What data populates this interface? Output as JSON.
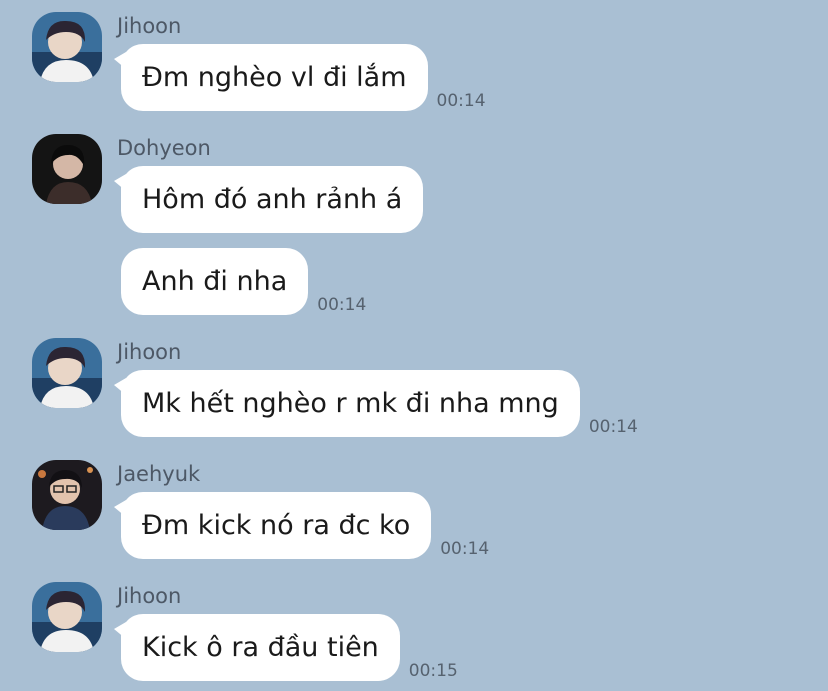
{
  "messages": [
    {
      "sender": "Jihoon",
      "text": "Đm nghèo vl đi lắm",
      "time": "00:14",
      "avatar": "jihoon-avatar"
    },
    {
      "sender": "Dohyeon",
      "text": "Hôm đó anh rảnh á",
      "time": "",
      "avatar": "dohyeon-avatar"
    },
    {
      "sender": "",
      "text": "Anh đi nha",
      "time": "00:14",
      "avatar": ""
    },
    {
      "sender": "Jihoon",
      "text": "Mk hết nghèo r mk đi nha mng",
      "time": "00:14",
      "avatar": "jihoon-avatar"
    },
    {
      "sender": "Jaehyuk",
      "text": "Đm kick nó ra đc ko",
      "time": "00:14",
      "avatar": "jaehyuk-avatar"
    },
    {
      "sender": "Jihoon",
      "text": "Kick ô ra đầu tiên",
      "time": "00:15",
      "avatar": "jihoon-avatar"
    }
  ],
  "colors": {
    "background": "#a9bfd3",
    "bubble": "#ffffff",
    "sender_text": "#4d5866",
    "time_text": "#56626f"
  }
}
